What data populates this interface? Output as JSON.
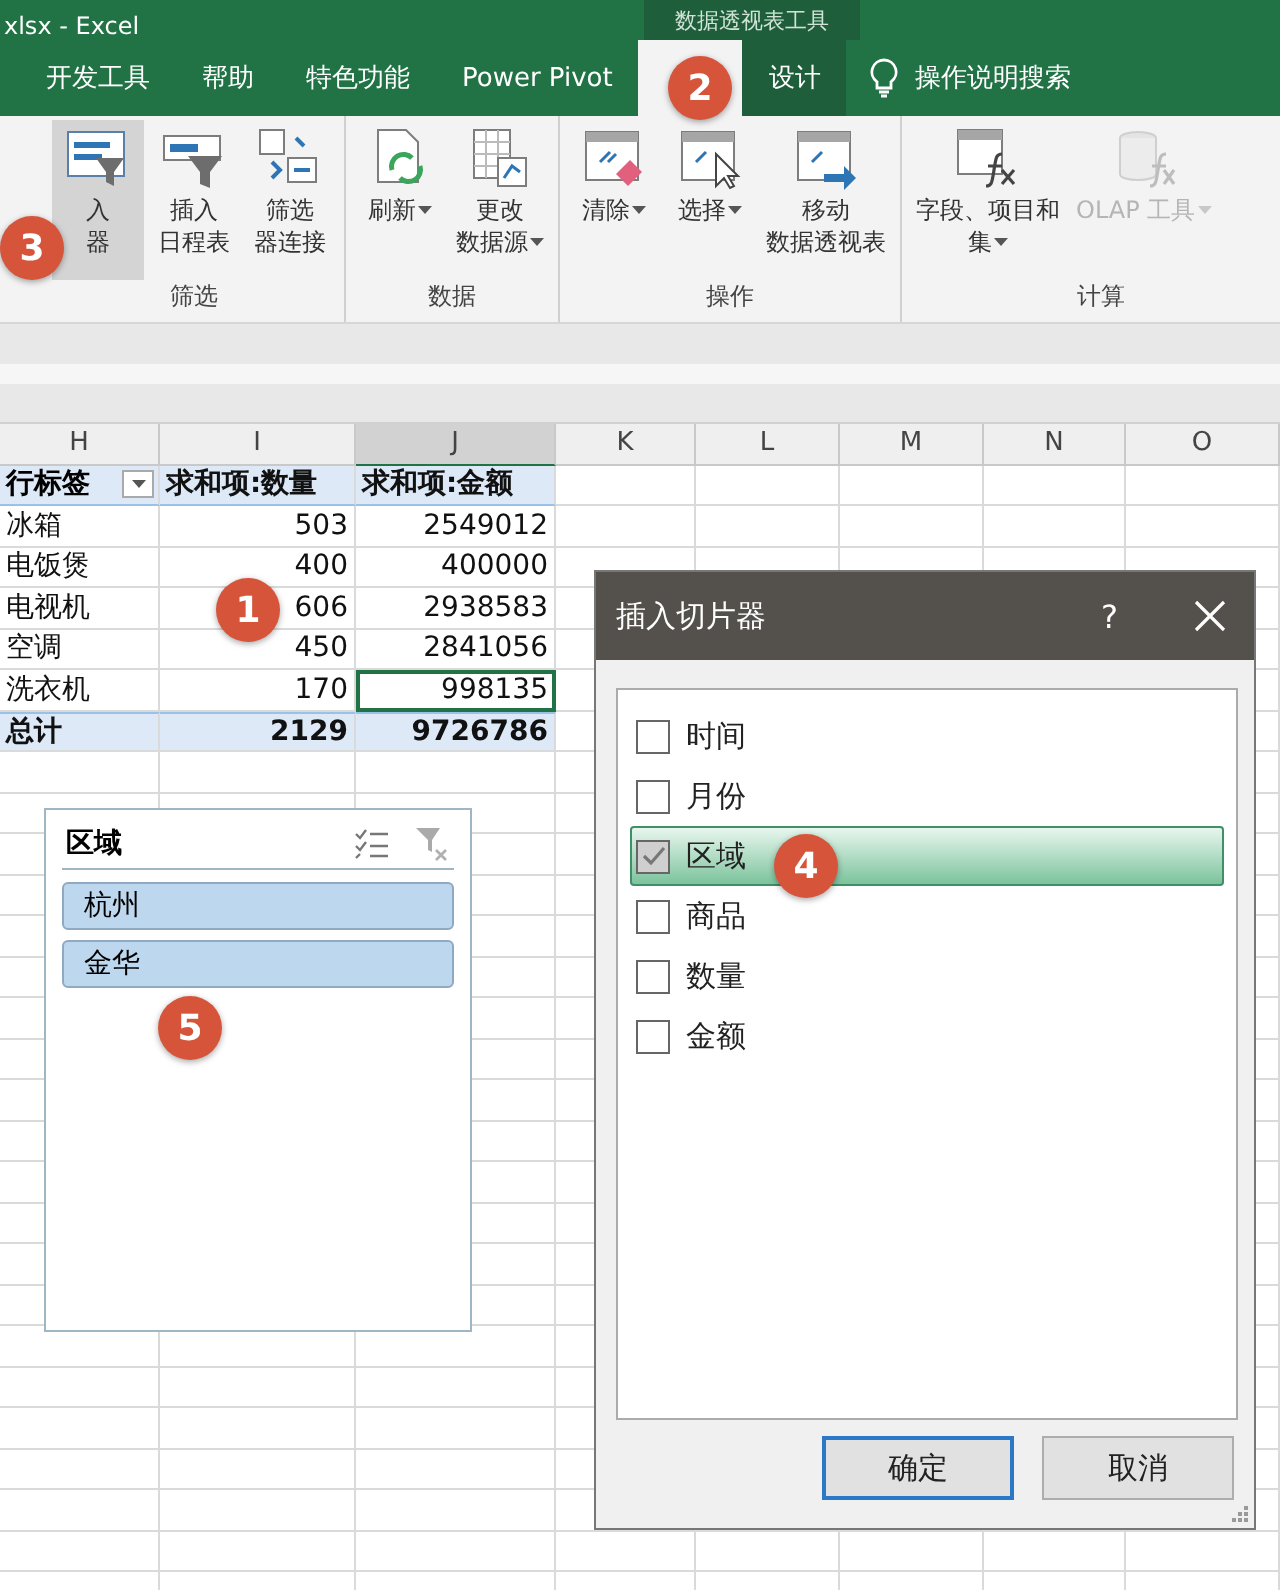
{
  "title_bar": {
    "title": "xlsx  -  Excel",
    "context_label": "数据透视表工具"
  },
  "tabs": [
    {
      "label": "开发工具",
      "selected": false,
      "contextual": false
    },
    {
      "label": "帮助",
      "selected": false,
      "contextual": false
    },
    {
      "label": "特色功能",
      "selected": false,
      "contextual": false
    },
    {
      "label": "Power Pivot",
      "selected": false,
      "contextual": false
    },
    {
      "selected": true,
      "contextual": true
    },
    {
      "label": "设计",
      "selected": false,
      "contextual": true
    }
  ],
  "tell_me": "操作说明搜索",
  "ribbon": [
    {
      "label": "筛选",
      "buttons": [
        {
          "kind": "slicer",
          "lines": [
            "入",
            "器"
          ],
          "pressed": true,
          "dropdown": false,
          "disabled": false
        },
        {
          "kind": "timeline",
          "lines": [
            "插入",
            "日程表"
          ],
          "pressed": false,
          "dropdown": false,
          "disabled": false
        },
        {
          "kind": "connections",
          "lines": [
            "筛选",
            "器连接"
          ],
          "pressed": false,
          "dropdown": false,
          "disabled": false
        }
      ]
    },
    {
      "label": "数据",
      "buttons": [
        {
          "kind": "refresh",
          "lines": [
            "刷新"
          ],
          "pressed": false,
          "dropdown": true,
          "disabled": false
        },
        {
          "kind": "datasource",
          "lines": [
            "更改",
            "数据源"
          ],
          "pressed": false,
          "dropdown": true,
          "disabled": false
        }
      ]
    },
    {
      "label": "操作",
      "buttons": [
        {
          "kind": "clear",
          "lines": [
            "清除"
          ],
          "pressed": false,
          "dropdown": true,
          "disabled": false
        },
        {
          "kind": "select",
          "lines": [
            "选择"
          ],
          "pressed": false,
          "dropdown": true,
          "disabled": false
        },
        {
          "kind": "move",
          "lines": [
            "移动",
            "数据透视表"
          ],
          "pressed": false,
          "dropdown": false,
          "disabled": false
        }
      ]
    },
    {
      "label": "计算",
      "buttons": [
        {
          "kind": "fields",
          "lines": [
            "字段、项目和",
            "集"
          ],
          "pressed": false,
          "dropdown": true,
          "disabled": false
        },
        {
          "kind": "olap",
          "lines": [
            "OLAP 工具"
          ],
          "pressed": false,
          "dropdown": true,
          "disabled": true
        }
      ]
    }
  ],
  "sheet": {
    "columns": [
      "H",
      "I",
      "J",
      "K",
      "L",
      "M",
      "N",
      "O"
    ],
    "header": [
      "行标签",
      "求和项:数量",
      "求和项:金额"
    ],
    "rows": [
      {
        "cells": [
          "冰箱",
          "503",
          "2549012"
        ],
        "selected": false
      },
      {
        "cells": [
          "电饭煲",
          "400",
          "400000"
        ],
        "selected": false
      },
      {
        "cells": [
          "电视机",
          "606",
          "2938583"
        ],
        "selected": false
      },
      {
        "cells": [
          "空调",
          "450",
          "2841056"
        ],
        "selected": false
      },
      {
        "cells": [
          "洗衣机",
          "170",
          "998135"
        ],
        "selected": true
      }
    ],
    "total": [
      "总计",
      "2129",
      "9726786"
    ]
  },
  "slicer": {
    "title": "区域",
    "items": [
      {
        "label": "杭州",
        "selected": true
      },
      {
        "label": "金华",
        "selected": true
      }
    ]
  },
  "dialog": {
    "title": "插入切片器",
    "help": "?",
    "fields": [
      {
        "label": "时间",
        "checked": false,
        "selected": false
      },
      {
        "label": "月份",
        "checked": false,
        "selected": false
      },
      {
        "label": "区域",
        "checked": true,
        "selected": true
      },
      {
        "label": "商品",
        "checked": false,
        "selected": false
      },
      {
        "label": "数量",
        "checked": false,
        "selected": false
      },
      {
        "label": "金额",
        "checked": false,
        "selected": false
      }
    ],
    "buttons": [
      {
        "label": "确定",
        "default": true
      },
      {
        "label": "取消",
        "default": false
      }
    ]
  },
  "badges": [
    "1",
    "2",
    "3",
    "4",
    "5"
  ]
}
